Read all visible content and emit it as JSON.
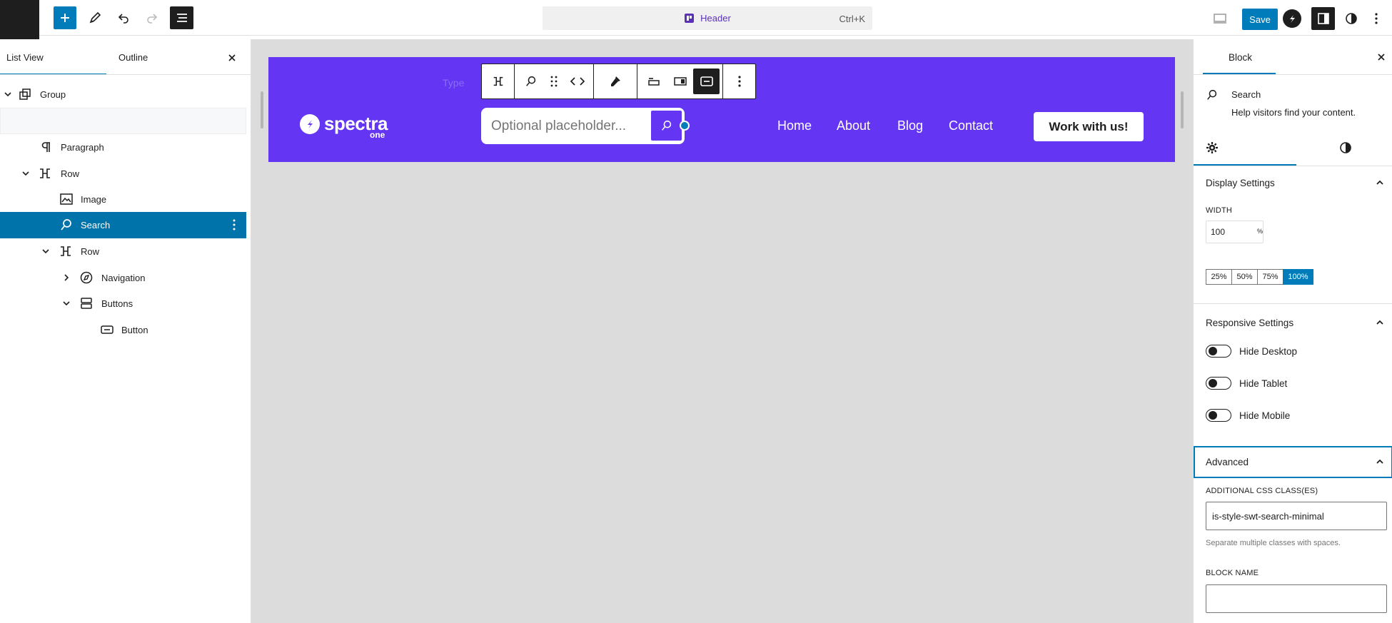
{
  "topbar": {
    "document_title": "Header",
    "shortcut": "Ctrl+K",
    "save_label": "Save"
  },
  "left_panel": {
    "tabs": [
      {
        "label": "List View",
        "active": true
      },
      {
        "label": "Outline",
        "active": false
      }
    ],
    "tree": [
      {
        "label": "Group",
        "icon": "group-icon"
      },
      {
        "label": "",
        "icon": ""
      },
      {
        "label": "Paragraph",
        "icon": "paragraph-icon"
      },
      {
        "label": "Row",
        "icon": "row-icon"
      },
      {
        "label": "Image",
        "icon": "image-icon"
      },
      {
        "label": "Search",
        "icon": "search-icon",
        "selected": true
      },
      {
        "label": "Row",
        "icon": "row-icon"
      },
      {
        "label": "Navigation",
        "icon": "navigation-icon"
      },
      {
        "label": "Buttons",
        "icon": "buttons-icon"
      },
      {
        "label": "Button",
        "icon": "button-icon"
      }
    ]
  },
  "canvas": {
    "toolbar_ghost_label": "Type",
    "logo_text": "spectra",
    "logo_sub": "one",
    "search_placeholder": "Optional placeholder...",
    "nav_items": [
      "Home",
      "About",
      "Blog",
      "Contact"
    ],
    "cta_label": "Work with us!",
    "header_color": "#6436f4"
  },
  "right_panel": {
    "tab_label": "Block",
    "block_name": "Search",
    "block_description": "Help visitors find your content.",
    "display_settings": {
      "title": "Display Settings",
      "width_label": "WIDTH",
      "width_value": "100",
      "width_unit": "%",
      "presets": [
        "25%",
        "50%",
        "75%",
        "100%"
      ],
      "active_preset": "100%"
    },
    "responsive_settings": {
      "title": "Responsive Settings",
      "toggles": [
        {
          "label": "Hide Desktop",
          "on": false
        },
        {
          "label": "Hide Tablet",
          "on": false
        },
        {
          "label": "Hide Mobile",
          "on": false
        }
      ]
    },
    "advanced": {
      "title": "Advanced",
      "css_label": "ADDITIONAL CSS CLASS(ES)",
      "css_value": "is-style-swt-search-minimal",
      "css_help": "Separate multiple classes with spaces.",
      "block_name_label": "BLOCK NAME",
      "block_name_value": ""
    },
    "accent": "#007cba"
  }
}
